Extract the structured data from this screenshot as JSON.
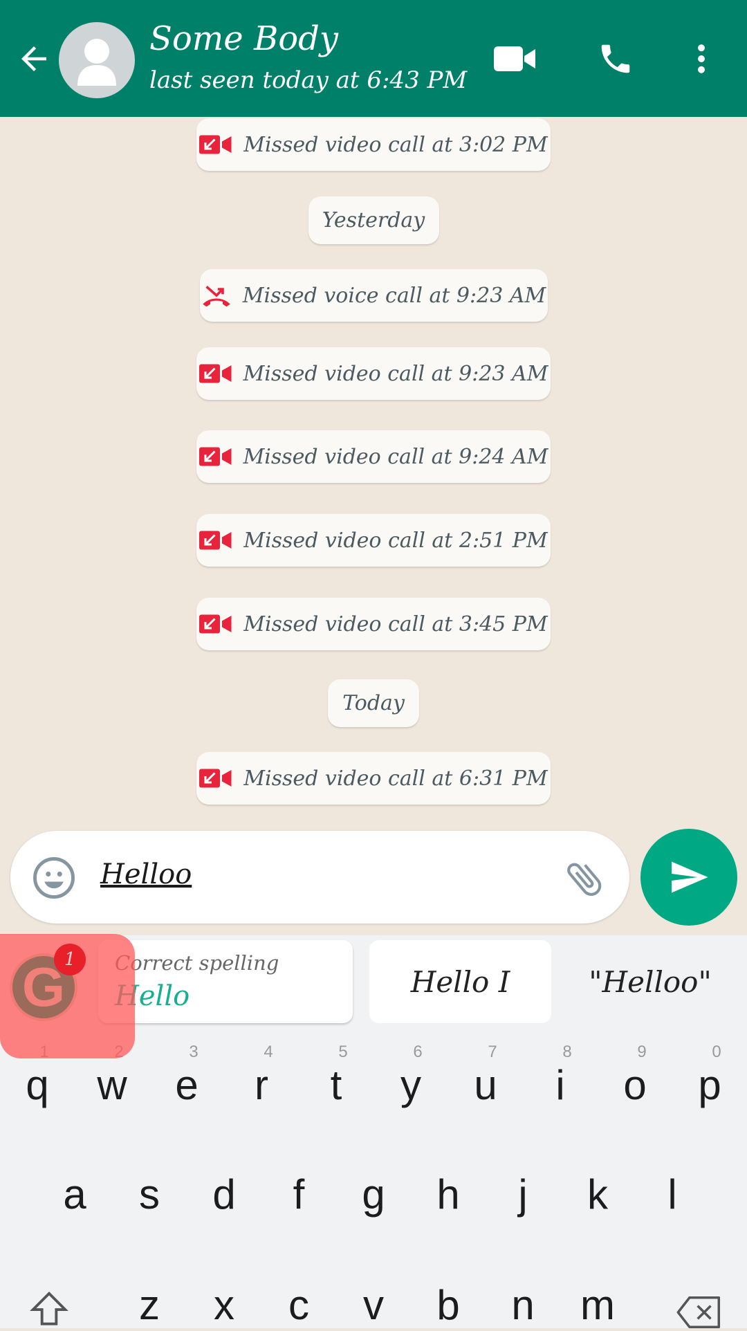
{
  "header": {
    "contact_name": "Some Body",
    "last_seen": "last seen today at 6:43 PM",
    "icons": [
      "back-arrow-icon",
      "avatar-icon",
      "video-call-icon",
      "phone-icon",
      "more-vert-icon"
    ],
    "color": "#008069"
  },
  "messages": [
    {
      "type": "video",
      "text": "Missed video call at 3:02 PM"
    },
    {
      "type": "date",
      "text": "Yesterday"
    },
    {
      "type": "voice",
      "text": "Missed voice call at 9:23 AM"
    },
    {
      "type": "video",
      "text": "Missed video call at 9:23 AM"
    },
    {
      "type": "video",
      "text": "Missed video call at 9:24 AM"
    },
    {
      "type": "video",
      "text": "Missed video call at 2:51 PM"
    },
    {
      "type": "video",
      "text": "Missed video call at 3:45 PM"
    },
    {
      "type": "date",
      "text": "Today"
    },
    {
      "type": "video",
      "text": "Missed video call at 6:31 PM"
    }
  ],
  "composer": {
    "value": "Helloo",
    "send_color": "#00a884"
  },
  "keyboard": {
    "grammarly_badge": "1",
    "suggestions": {
      "correct_label": "Correct spelling",
      "correct_word": "Hello",
      "s2": "Hello I",
      "s3": "\"Helloo\""
    },
    "number_hints": [
      "1",
      "2",
      "3",
      "4",
      "5",
      "6",
      "7",
      "8",
      "9",
      "0"
    ],
    "row1": [
      "q",
      "w",
      "e",
      "r",
      "t",
      "y",
      "u",
      "i",
      "o",
      "p"
    ],
    "row2": [
      "a",
      "s",
      "d",
      "f",
      "g",
      "h",
      "j",
      "k",
      "l"
    ],
    "row3": [
      "z",
      "x",
      "c",
      "v",
      "b",
      "n",
      "m"
    ]
  }
}
